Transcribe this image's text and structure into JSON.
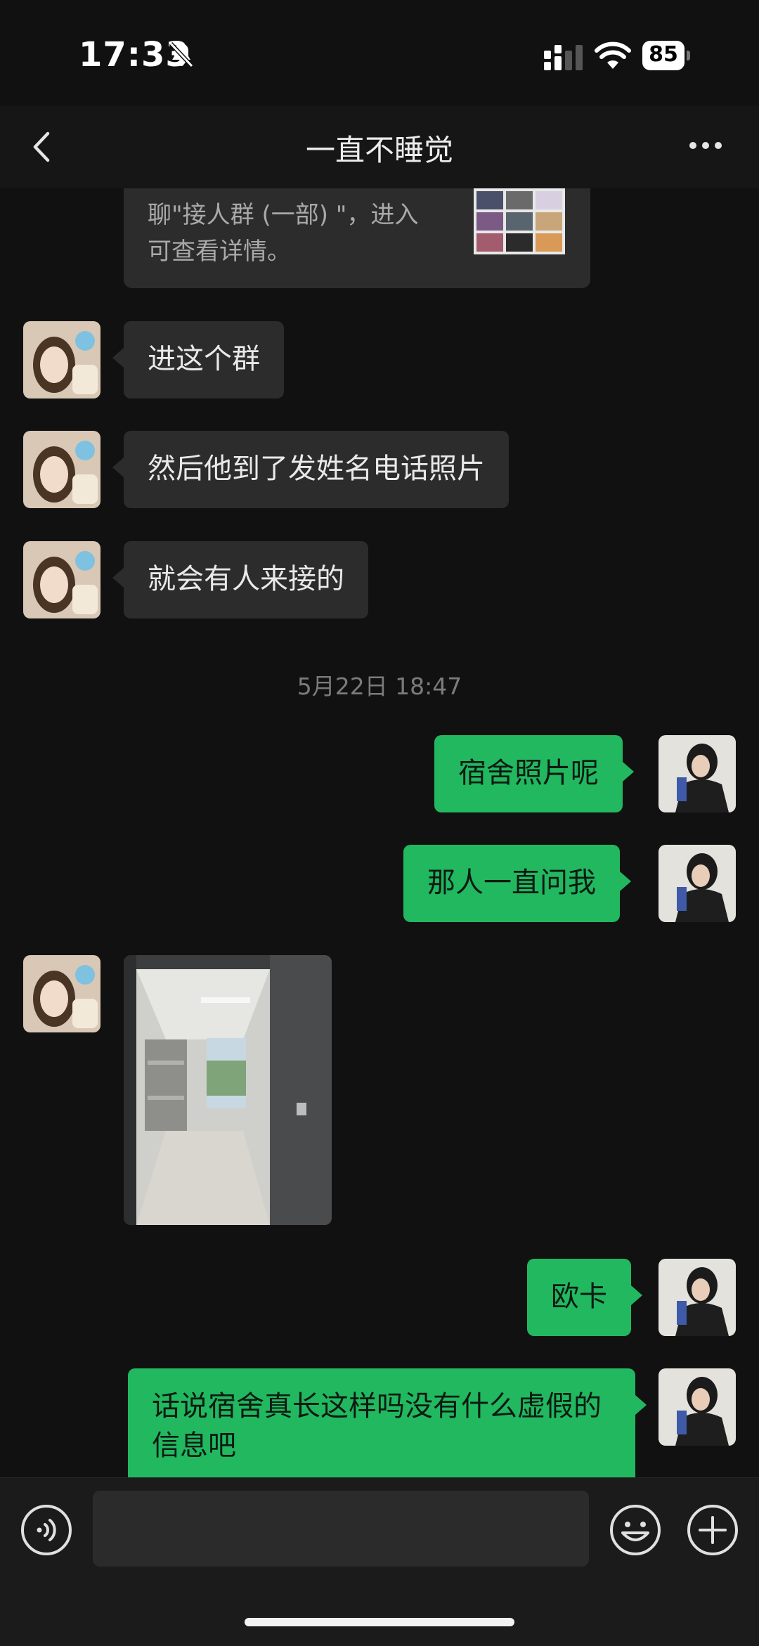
{
  "status_bar": {
    "time": "17:33",
    "battery": "85"
  },
  "nav": {
    "title": "一直不睡觉"
  },
  "card": {
    "text_line1": "聊\"接人群 (一部) \"，进入",
    "text_line2": "可查看详情。"
  },
  "messages": [
    {
      "side": "left",
      "text": "进这个群"
    },
    {
      "side": "left",
      "text": "然后他到了发姓名电话照片"
    },
    {
      "side": "left",
      "text": "就会有人来接的"
    },
    {
      "side": "right",
      "text": "宿舍照片呢"
    },
    {
      "side": "right",
      "text": "那人一直问我"
    },
    {
      "side": "right",
      "text": "欧卡"
    },
    {
      "side": "right",
      "text": "话说宿舍真长这样吗没有什么虚假的信息吧"
    }
  ],
  "timestamp": "5月22日 18:47",
  "input": {
    "value": ""
  },
  "colors": {
    "accent_green": "#21b860",
    "bubble_dark": "#2c2c2c",
    "background": "#111111"
  },
  "icons": {
    "back": "chevron-left-icon",
    "more": "more-dots-icon",
    "voice": "voice-icon",
    "emoji": "emoji-icon",
    "plus": "plus-circle-icon",
    "mute": "bell-slash-icon"
  }
}
